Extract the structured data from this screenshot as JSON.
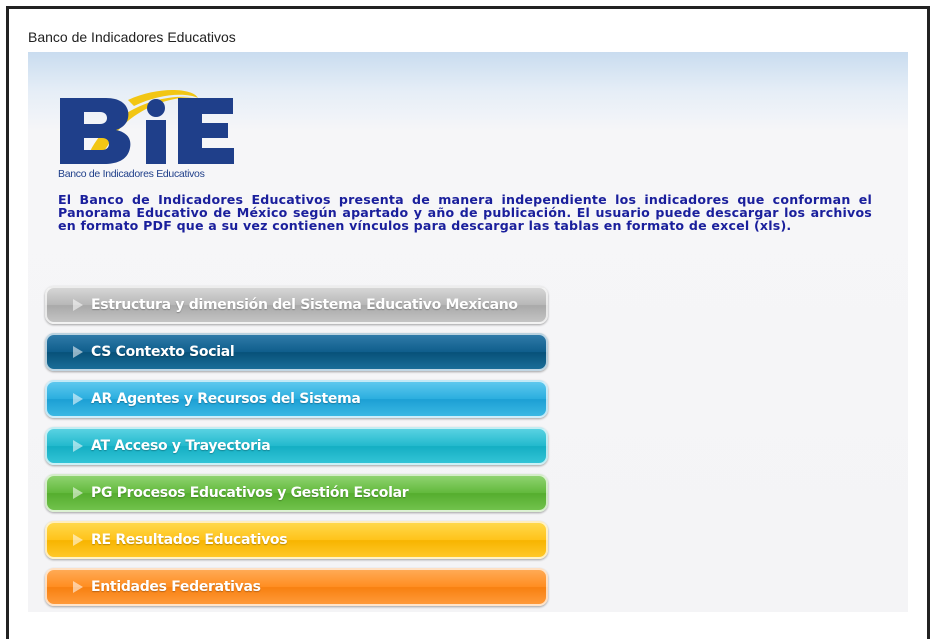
{
  "page": {
    "title": "Banco de Indicadores Educativos"
  },
  "logo": {
    "text": "BiE",
    "caption": "Banco de Indicadores Educativos"
  },
  "intro": "El Banco de Indicadores Educativos presenta de manera independiente los indicadores que conforman el Panorama Educativo de México según apartado y año de publicación. El usuario puede descargar los archivos en formato PDF que a su vez contienen vínculos para descargar las tablas en formato de excel (xls).",
  "menu": {
    "items": [
      {
        "label": "Estructura y dimensión del Sistema Educativo Mexicano",
        "color": "#b7b7b7"
      },
      {
        "label": "CS Contexto Social",
        "color": "#0f5e8c"
      },
      {
        "label": "AR Agentes y Recursos del Sistema",
        "color": "#2aaedf"
      },
      {
        "label": "AT Acceso y Trayectoria",
        "color": "#22b9cd"
      },
      {
        "label": "PG Procesos Educativos y Gestión Escolar",
        "color": "#62b93c"
      },
      {
        "label": "RE Resultados Educativos",
        "color": "#ffc31a"
      },
      {
        "label": "Entidades Federativas",
        "color": "#ff8d20"
      }
    ]
  },
  "icons": {
    "menu_arrow": "play-triangle-icon"
  }
}
